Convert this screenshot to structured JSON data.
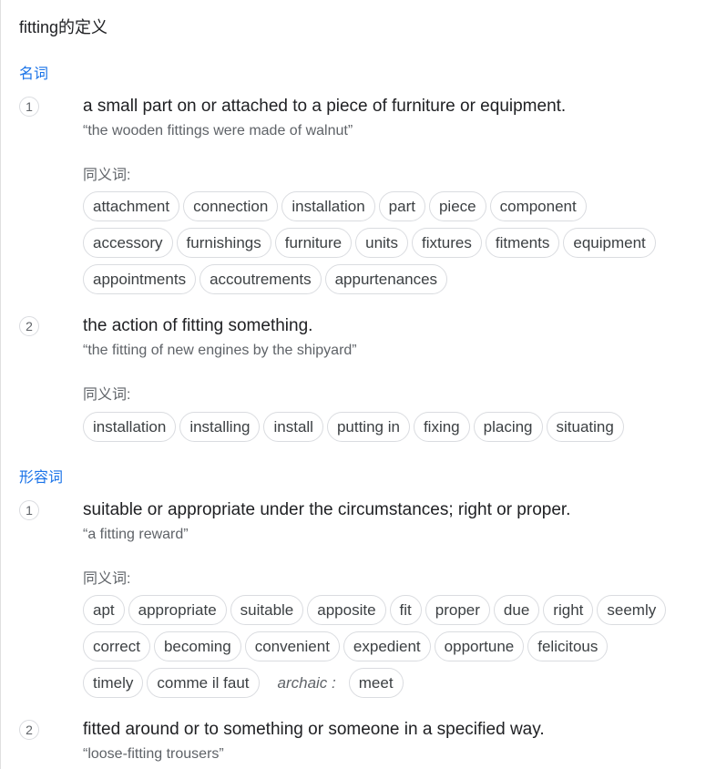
{
  "title": "fitting的定义",
  "noun": {
    "label": "名词",
    "senses": [
      {
        "num": "1",
        "definition": "a small part on or attached to a piece of furniture or equipment.",
        "example": "“the wooden fittings were made of walnut”",
        "syn_label": "同义词:",
        "syn_rows": [
          [
            "attachment",
            "connection",
            "installation",
            "part",
            "piece",
            "component"
          ],
          [
            "accessory",
            "furnishings",
            "furniture",
            "units",
            "fixtures",
            "fitments",
            "equipment"
          ],
          [
            "appointments",
            "accoutrements",
            "appurtenances"
          ]
        ]
      },
      {
        "num": "2",
        "definition": "the action of fitting something.",
        "example": "“the fitting of new engines by the shipyard”",
        "syn_label": "同义词:",
        "syn_rows": [
          [
            "installation",
            "installing",
            "install",
            "putting in",
            "fixing",
            "placing",
            "situating"
          ]
        ]
      }
    ]
  },
  "adjective": {
    "label": "形容词",
    "senses": [
      {
        "num": "1",
        "definition": "suitable or appropriate under the circumstances; right or proper.",
        "example": "“a fitting reward”",
        "syn_label": "同义词:",
        "syn_rows": [
          [
            "apt",
            "appropriate",
            "suitable",
            "apposite",
            "fit",
            "proper",
            "due",
            "right",
            "seemly"
          ],
          [
            "correct",
            "becoming",
            "convenient",
            "expedient",
            "opportune",
            "felicitous"
          ],
          [
            "timely",
            "comme il faut"
          ]
        ],
        "archaic_label": "archaic :",
        "archaic_syn": "meet"
      },
      {
        "num": "2",
        "definition": "fitted around or to something or someone in a specified way.",
        "example": "“loose-fitting trousers”"
      }
    ]
  }
}
